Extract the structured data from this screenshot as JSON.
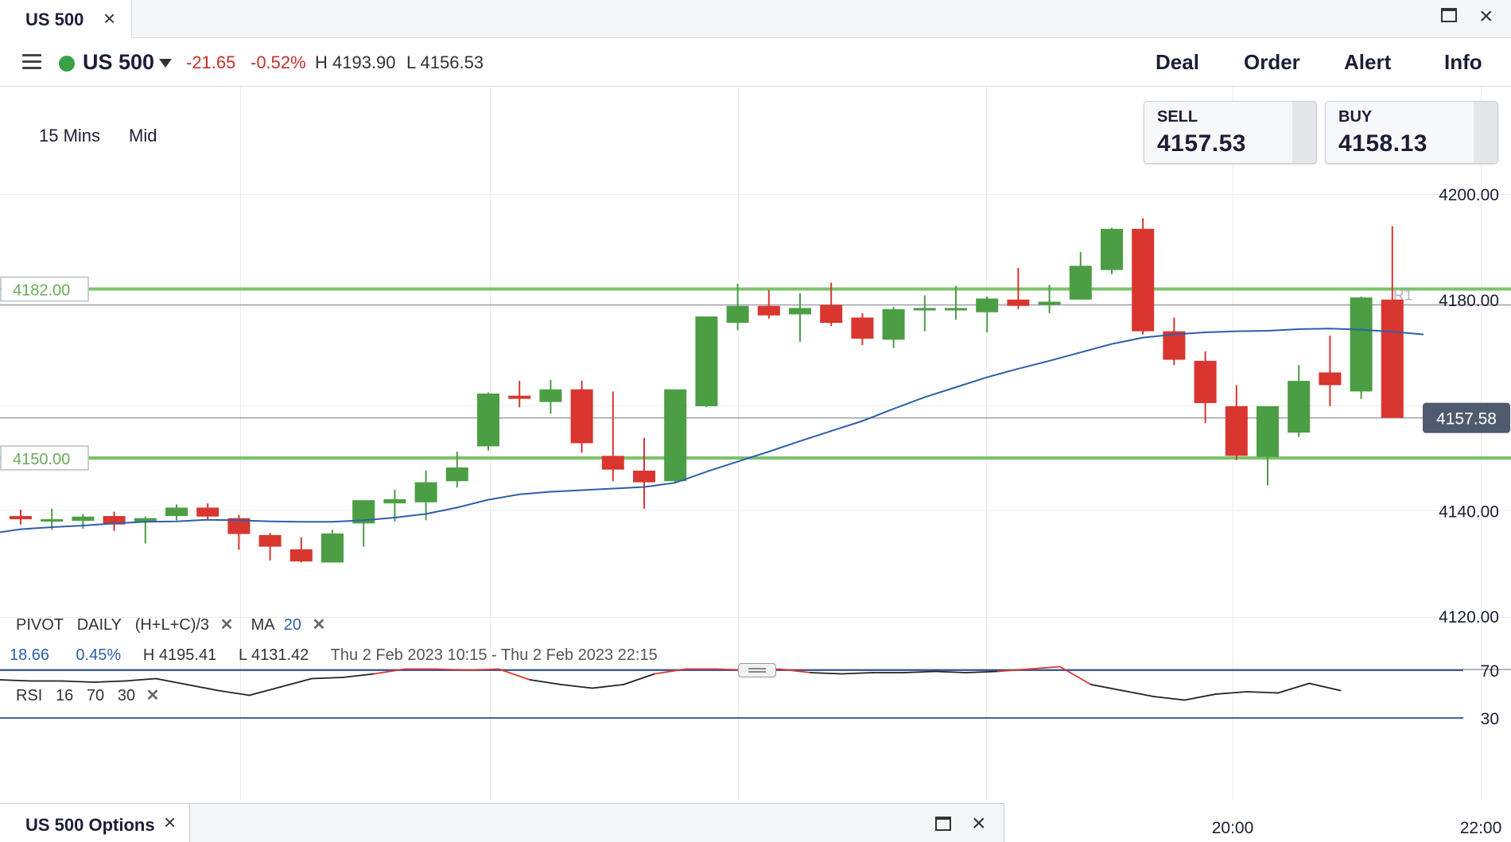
{
  "window": {
    "tab_title": "US 500",
    "close_icon": "×"
  },
  "toolbar": {
    "instrument": "US 500",
    "change": "-21.65",
    "change_pct": "-0.52%",
    "high": "H 4193.90",
    "low": "L 4156.53",
    "menu": [
      "Deal",
      "Order",
      "Alert",
      "Info"
    ]
  },
  "chart_controls": {
    "timeframe": "15 Mins",
    "price_type": "Mid"
  },
  "quote": {
    "sell_label": "SELL",
    "sell_price": "4157.53",
    "buy_label": "BUY",
    "buy_price": "4158.13"
  },
  "colors": {
    "up": "#4b9e44",
    "down": "#d8362f",
    "level_line": "#7cc26a",
    "ma": "#2d5fa8",
    "rsi": "#222222",
    "rsi_over": "#d8362f",
    "rsi_band": "#2b4c8c",
    "last_price_bg": "#4e5a6e"
  },
  "legend": {
    "pivot_label": "PIVOT",
    "pivot_period": "DAILY",
    "pivot_formula": "(H+L+C)/3",
    "ma_label": "MA",
    "ma_period": "20",
    "range_change": "18.66",
    "range_pct": "0.45%",
    "range_high": "H 4195.41",
    "range_low": "L 4131.42",
    "range_dates": "Thu 2 Feb 2023 10:15 - Thu 2 Feb 2023 22:15",
    "rsi_label": "RSI",
    "rsi_period": "16",
    "rsi_upper": "70",
    "rsi_lower": "30"
  },
  "chart_data": {
    "type": "candlestick",
    "price_axis": {
      "ticks": [
        "4200.00",
        "4180.00",
        "4140.00",
        "4120.00"
      ],
      "ylim": [
        4115,
        4220
      ]
    },
    "levels": [
      {
        "value": 4182.0,
        "label": "4182.00"
      },
      {
        "value": 4150.0,
        "label": "4150.00"
      }
    ],
    "pivot_label": "R1",
    "last_price": {
      "value": 4157.58,
      "label": "4157.58"
    },
    "time_labels": [
      "20:00",
      "22:00"
    ],
    "candles": [
      {
        "o": 4139.0,
        "h": 4140.2,
        "l": 4137.4,
        "c": 4138.4
      },
      {
        "o": 4138.4,
        "h": 4140.4,
        "l": 4136.4,
        "c": 4138.4
      },
      {
        "o": 4138.1,
        "h": 4139.4,
        "l": 4136.6,
        "c": 4138.9
      },
      {
        "o": 4139.0,
        "h": 4139.8,
        "l": 4136.2,
        "c": 4137.4
      },
      {
        "o": 4137.9,
        "h": 4138.9,
        "l": 4133.8,
        "c": 4138.6
      },
      {
        "o": 4139.0,
        "h": 4141.2,
        "l": 4138.2,
        "c": 4140.6
      },
      {
        "o": 4140.6,
        "h": 4141.4,
        "l": 4138.2,
        "c": 4138.9
      },
      {
        "o": 4138.6,
        "h": 4139.2,
        "l": 4132.6,
        "c": 4135.6
      },
      {
        "o": 4135.4,
        "h": 4135.8,
        "l": 4130.6,
        "c": 4133.2
      },
      {
        "o": 4132.7,
        "h": 4135.0,
        "l": 4130.2,
        "c": 4130.4
      },
      {
        "o": 4130.2,
        "h": 4136.4,
        "l": 4130.2,
        "c": 4135.7
      },
      {
        "o": 4137.6,
        "h": 4142.0,
        "l": 4133.2,
        "c": 4142.0
      },
      {
        "o": 4141.4,
        "h": 4144.0,
        "l": 4138.0,
        "c": 4142.2
      },
      {
        "o": 4141.6,
        "h": 4147.6,
        "l": 4138.2,
        "c": 4145.4
      },
      {
        "o": 4145.6,
        "h": 4151.2,
        "l": 4144.4,
        "c": 4148.2
      },
      {
        "o": 4152.2,
        "h": 4162.4,
        "l": 4151.4,
        "c": 4162.2
      },
      {
        "o": 4161.8,
        "h": 4164.6,
        "l": 4159.6,
        "c": 4161.2
      },
      {
        "o": 4160.6,
        "h": 4164.8,
        "l": 4158.4,
        "c": 4163.0
      },
      {
        "o": 4163.0,
        "h": 4164.6,
        "l": 4151.0,
        "c": 4152.8
      },
      {
        "o": 4150.4,
        "h": 4162.6,
        "l": 4145.6,
        "c": 4147.8
      },
      {
        "o": 4147.6,
        "h": 4153.8,
        "l": 4140.4,
        "c": 4145.4
      },
      {
        "o": 4145.6,
        "h": 4162.6,
        "l": 4145.2,
        "c": 4163.0
      },
      {
        "o": 4159.8,
        "h": 4176.6,
        "l": 4159.6,
        "c": 4176.8
      },
      {
        "o": 4175.6,
        "h": 4183.0,
        "l": 4174.2,
        "c": 4178.8
      },
      {
        "o": 4178.8,
        "h": 4181.8,
        "l": 4176.4,
        "c": 4177.0
      },
      {
        "o": 4177.2,
        "h": 4181.2,
        "l": 4172.0,
        "c": 4178.4
      },
      {
        "o": 4179.0,
        "h": 4183.2,
        "l": 4175.0,
        "c": 4175.6
      },
      {
        "o": 4176.6,
        "h": 4177.4,
        "l": 4171.4,
        "c": 4172.6
      },
      {
        "o": 4172.4,
        "h": 4178.6,
        "l": 4170.8,
        "c": 4178.2
      },
      {
        "o": 4178.2,
        "h": 4180.8,
        "l": 4174.0,
        "c": 4178.4
      },
      {
        "o": 4178.4,
        "h": 4182.6,
        "l": 4176.2,
        "c": 4178.4
      },
      {
        "o": 4177.6,
        "h": 4180.6,
        "l": 4173.8,
        "c": 4180.2
      },
      {
        "o": 4180.0,
        "h": 4186.0,
        "l": 4178.2,
        "c": 4178.8
      },
      {
        "o": 4179.0,
        "h": 4182.8,
        "l": 4177.4,
        "c": 4179.6
      },
      {
        "o": 4180.0,
        "h": 4189.0,
        "l": 4180.0,
        "c": 4186.4
      },
      {
        "o": 4185.6,
        "h": 4193.6,
        "l": 4184.8,
        "c": 4193.4
      },
      {
        "o": 4193.4,
        "h": 4195.4,
        "l": 4173.4,
        "c": 4174.0
      },
      {
        "o": 4174.0,
        "h": 4176.6,
        "l": 4167.6,
        "c": 4168.6
      },
      {
        "o": 4168.4,
        "h": 4170.2,
        "l": 4156.6,
        "c": 4160.4
      },
      {
        "o": 4159.8,
        "h": 4163.8,
        "l": 4149.6,
        "c": 4150.4
      },
      {
        "o": 4150.2,
        "h": 4159.8,
        "l": 4144.8,
        "c": 4159.8
      },
      {
        "o": 4154.8,
        "h": 4167.6,
        "l": 4154.0,
        "c": 4164.6
      },
      {
        "o": 4166.2,
        "h": 4173.2,
        "l": 4159.8,
        "c": 4163.8
      },
      {
        "o": 4162.6,
        "h": 4180.6,
        "l": 4161.2,
        "c": 4180.4
      },
      {
        "o": 4180.0,
        "h": 4193.9,
        "l": 4157.6,
        "c": 4157.6
      }
    ],
    "ma": [
      4136.5,
      4136.9,
      4137.2,
      4137.6,
      4137.9,
      4138.0,
      4138.3,
      4138.2,
      4138.0,
      4137.9,
      4137.9,
      4138.2,
      4138.7,
      4139.4,
      4140.6,
      4142.1,
      4143.1,
      4143.6,
      4143.9,
      4144.2,
      4144.5,
      4145.3,
      4147.4,
      4149.3,
      4151.2,
      4153.2,
      4155.1,
      4157.0,
      4159.3,
      4161.5,
      4163.4,
      4165.3,
      4166.9,
      4168.4,
      4170.0,
      4171.6,
      4172.8,
      4173.4,
      4173.8,
      4174.0,
      4174.1,
      4174.4,
      4174.5,
      4174.3,
      4173.9,
      4173.4
    ],
    "rsi": {
      "upper": 70,
      "lower": 30,
      "values": [
        62,
        61,
        61,
        60,
        61,
        63,
        58,
        53,
        49,
        56,
        63,
        64,
        67,
        71,
        71,
        70,
        71,
        62,
        58,
        55,
        58,
        67,
        71,
        71,
        70,
        71,
        68,
        67,
        68,
        68,
        69,
        68,
        69,
        71,
        73,
        58,
        53,
        48,
        45,
        50,
        52,
        51,
        59,
        53
      ]
    }
  }
}
